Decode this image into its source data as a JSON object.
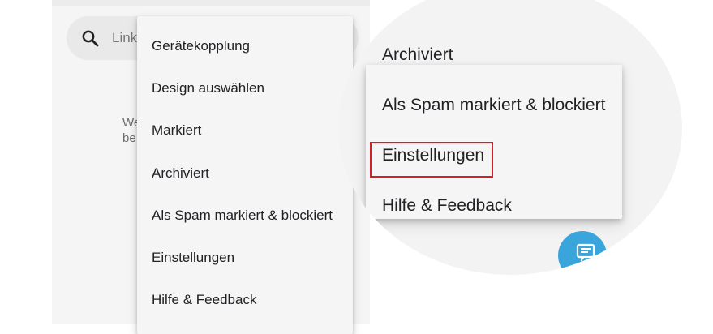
{
  "search": {
    "placeholder": "Link",
    "icon": "search-icon"
  },
  "background_text": "We\nbe",
  "menu": {
    "items": [
      {
        "label": "Gerätekopplung"
      },
      {
        "label": "Design auswählen"
      },
      {
        "label": "Markiert"
      },
      {
        "label": "Archiviert"
      },
      {
        "label": "Als Spam markiert & blockiert"
      },
      {
        "label": "Einstellungen"
      },
      {
        "label": "Hilfe & Feedback"
      }
    ]
  },
  "zoom": {
    "items": [
      {
        "label": "Archiviert"
      },
      {
        "label": "Als Spam markiert & blockiert"
      },
      {
        "label": "Einstellungen",
        "highlighted": true
      },
      {
        "label": "Hilfe & Feedback"
      }
    ],
    "fab_icon": "new-message-icon"
  },
  "colors": {
    "highlight": "#d0212b",
    "fab": "#3aa5db",
    "menu_bg": "#f5f5f5",
    "text": "#202124"
  }
}
